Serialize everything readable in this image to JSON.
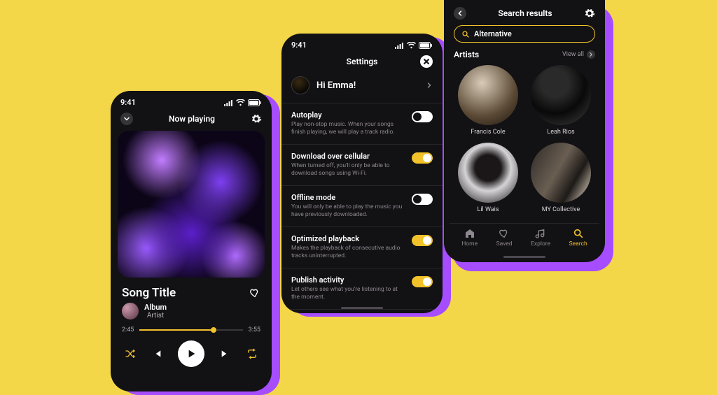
{
  "colors": {
    "accent": "#f2c22b",
    "shadow": "#a64dff",
    "bg": "#f4d649"
  },
  "status": {
    "time": "9:41"
  },
  "now_playing": {
    "header_title": "Now playing",
    "song_title": "Song Title",
    "album": "Album",
    "artist": "Artist",
    "elapsed": "2:45",
    "remaining": "3:55"
  },
  "settings": {
    "title": "Settings",
    "greeting": "Hi Emma!",
    "items": [
      {
        "label": "Autoplay",
        "desc": "Play non-stop music. When your songs finish playing, we will play a track radio.",
        "on": false
      },
      {
        "label": "Download over cellular",
        "desc": "When turned off, you'll only be able to download songs using Wi-Fi.",
        "on": true
      },
      {
        "label": "Offline mode",
        "desc": "You will only be able to play the music you have previously downloaded.",
        "on": false
      },
      {
        "label": "Optimized playback",
        "desc": "Makes the playback of consecutive audio tracks uninterrupted.",
        "on": true
      },
      {
        "label": "Publish activity",
        "desc": "Let others see what you're listening to at the moment.",
        "on": true
      }
    ]
  },
  "search": {
    "title": "Search results",
    "query": "Alternative",
    "section_title": "Artists",
    "view_all": "View all",
    "artists": [
      {
        "name": "Francis Cole"
      },
      {
        "name": "Leah Rios"
      },
      {
        "name": "Lil Wais"
      },
      {
        "name": "MY Collective"
      }
    ],
    "tabs": [
      {
        "label": "Home",
        "icon": "home",
        "active": false
      },
      {
        "label": "Saved",
        "icon": "heart",
        "active": false
      },
      {
        "label": "Explore",
        "icon": "music",
        "active": false
      },
      {
        "label": "Search",
        "icon": "search",
        "active": true
      }
    ]
  }
}
